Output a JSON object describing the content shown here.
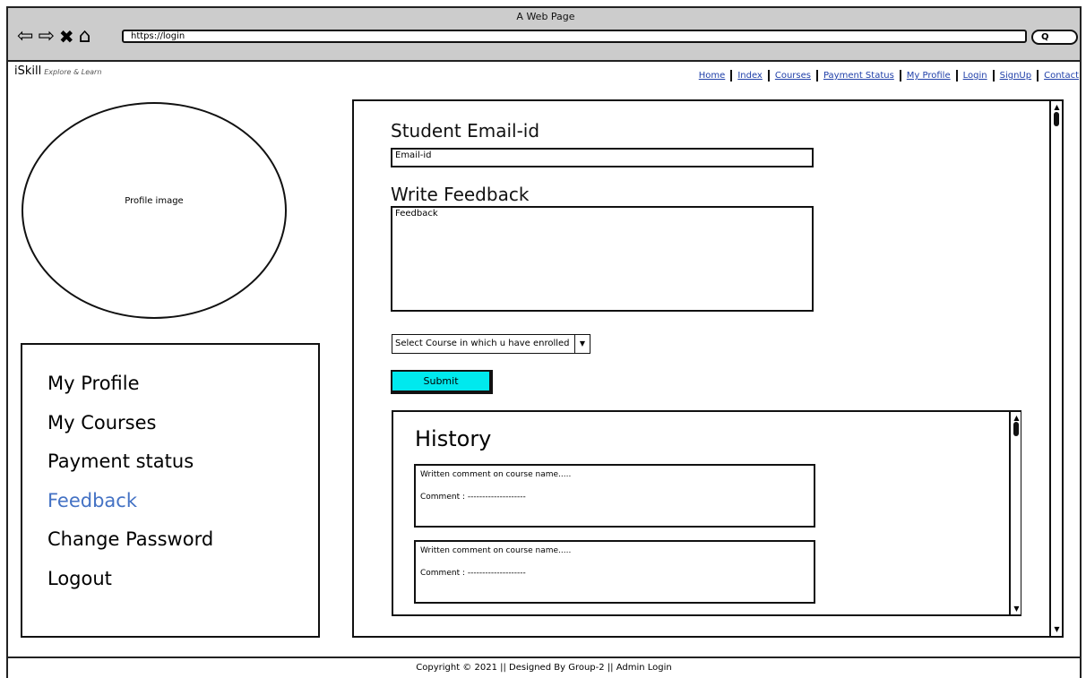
{
  "browser": {
    "window_title": "A Web Page",
    "address": "https://login",
    "search_label": "Q",
    "nav_icons": [
      "back-arrow-icon",
      "forward-arrow-icon",
      "close-x-icon",
      "home-icon"
    ]
  },
  "site": {
    "logo": "iSkill",
    "tagline": "Explore & Learn",
    "nav": [
      {
        "label": "Home"
      },
      {
        "label": "Index"
      },
      {
        "label": "Courses"
      },
      {
        "label": "Payment Status"
      },
      {
        "label": "My Profile"
      },
      {
        "label": "Login"
      },
      {
        "label": "SignUp"
      },
      {
        "label": "Contact"
      }
    ]
  },
  "profile": {
    "image_label": "Profile image"
  },
  "sidebar": {
    "items": [
      {
        "label": "My Profile",
        "active": false
      },
      {
        "label": "My Courses",
        "active": false
      },
      {
        "label": "Payment status",
        "active": false
      },
      {
        "label": "Feedback",
        "active": true
      },
      {
        "label": "Change Password",
        "active": false
      },
      {
        "label": "Logout",
        "active": false
      }
    ],
    "active_color": "#4472c4"
  },
  "form": {
    "email_heading": "Student Email-id",
    "email_placeholder": "Email-id",
    "feedback_heading": "Write Feedback",
    "feedback_placeholder": "Feedback",
    "course_select_value": "Select Course in which u have enrolled",
    "submit_label": "Submit",
    "submit_color": "#00e9ee"
  },
  "history": {
    "title": "History",
    "entries": [
      {
        "line1": "Written comment on course name.....",
        "line2": "Comment : --------------------"
      },
      {
        "line1": "Written comment on course name.....",
        "line2": "Comment : --------------------"
      }
    ]
  },
  "footer": {
    "text": "Copyright © 2021 || Designed By Group-2 || Admin Login"
  }
}
